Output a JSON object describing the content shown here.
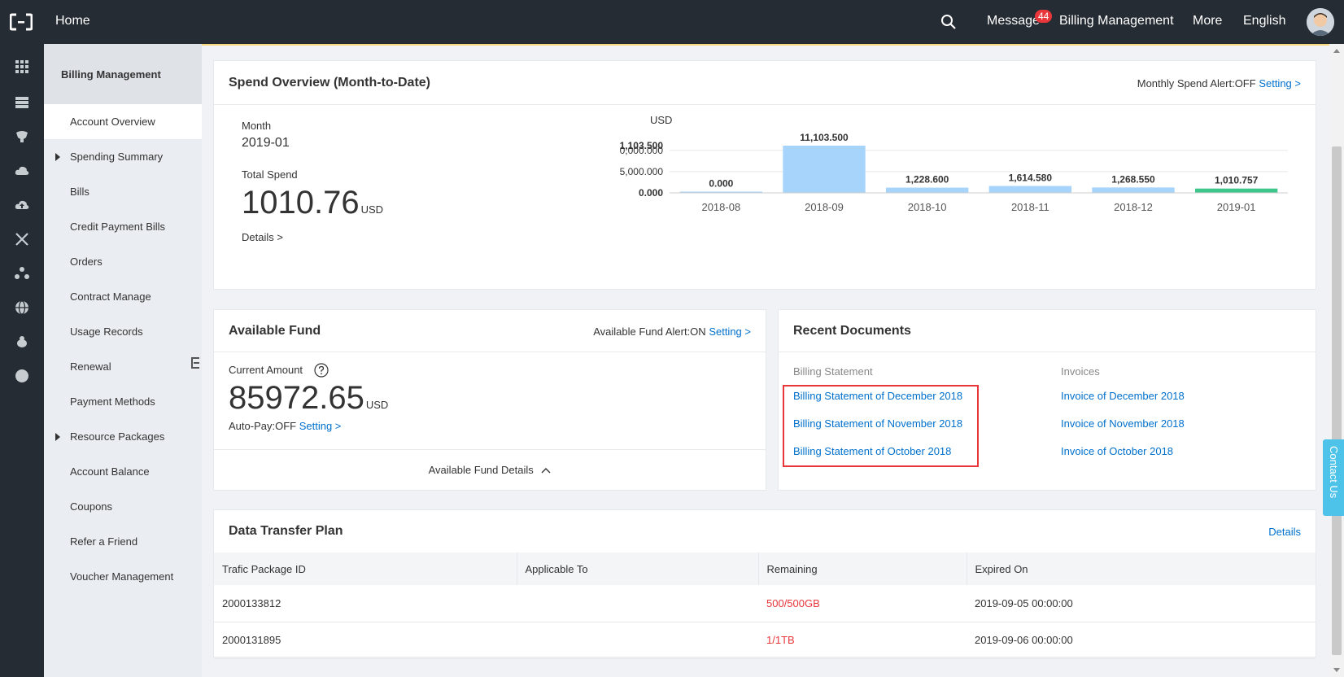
{
  "topbar": {
    "home": "Home",
    "message": "Message",
    "message_count": "44",
    "billing": "Billing Management",
    "more": "More",
    "language": "English"
  },
  "sidebar": {
    "title": "Billing Management",
    "items": [
      {
        "label": "Account Overview"
      },
      {
        "label": "Spending Summary"
      },
      {
        "label": "Bills"
      },
      {
        "label": "Credit Payment Bills"
      },
      {
        "label": "Orders"
      },
      {
        "label": "Contract Manage"
      },
      {
        "label": "Usage Records"
      },
      {
        "label": "Renewal"
      },
      {
        "label": "Payment Methods"
      },
      {
        "label": "Resource Packages"
      },
      {
        "label": "Account Balance"
      },
      {
        "label": "Coupons"
      },
      {
        "label": "Refer a Friend"
      },
      {
        "label": "Voucher Management"
      }
    ]
  },
  "spend": {
    "title": "Spend Overview (Month-to-Date)",
    "alert_label": "Monthly Spend Alert:OFF",
    "setting": "Setting >",
    "month_label": "Month",
    "month_value": "2019-01",
    "total_label": "Total Spend",
    "total_value": "1010.76",
    "total_unit": "USD",
    "details": "Details >"
  },
  "chart_data": {
    "type": "bar",
    "ylabel": "USD",
    "categories": [
      "2018-08",
      "2018-09",
      "2018-10",
      "2018-11",
      "2018-12",
      "2019-01"
    ],
    "values": [
      0.0,
      11103.5,
      1228.6,
      1614.58,
      1268.55,
      1010.757
    ],
    "value_labels": [
      "0.000",
      "11,103.500",
      "1,228.600",
      "1,614.580",
      "1,268.550",
      "1,010.757"
    ],
    "yticks": [
      0,
      5000,
      10000,
      11103.5
    ],
    "ytick_labels": [
      "0.000",
      "5,000.000",
      "0,000.000",
      "1,103.500"
    ],
    "ylim": [
      0,
      11103.5
    ],
    "colors": {
      "bar": "#a7d4fb",
      "current": "#3cc68a",
      "grid": "#e6e8eb"
    }
  },
  "fund": {
    "title": "Available Fund",
    "alert_label": "Available Fund Alert:ON",
    "setting": "Setting >",
    "current_label": "Current Amount",
    "current_value": "85972.65",
    "current_unit": "USD",
    "autopay_label": "Auto-Pay:OFF",
    "autopay_setting": "Setting >",
    "details": "Available Fund Details"
  },
  "docs": {
    "title": "Recent Documents",
    "statement_head": "Billing Statement",
    "invoice_head": "Invoices",
    "statements": [
      "Billing Statement of December 2018",
      "Billing Statement of November 2018",
      "Billing Statement of October 2018"
    ],
    "invoices": [
      "Invoice of December 2018",
      "Invoice of November 2018",
      "Invoice of October 2018"
    ]
  },
  "plan": {
    "title": "Data Transfer Plan",
    "details": "Details",
    "columns": [
      "Trafic Package ID",
      "Applicable To",
      "Remaining",
      "Expired On"
    ],
    "rows": [
      [
        "2000133812",
        "",
        "500/500GB",
        "2019-09-05 00:00:00"
      ],
      [
        "2000131895",
        "",
        "1/1TB",
        "2019-09-06 00:00:00"
      ]
    ]
  },
  "contact": "Contact Us"
}
